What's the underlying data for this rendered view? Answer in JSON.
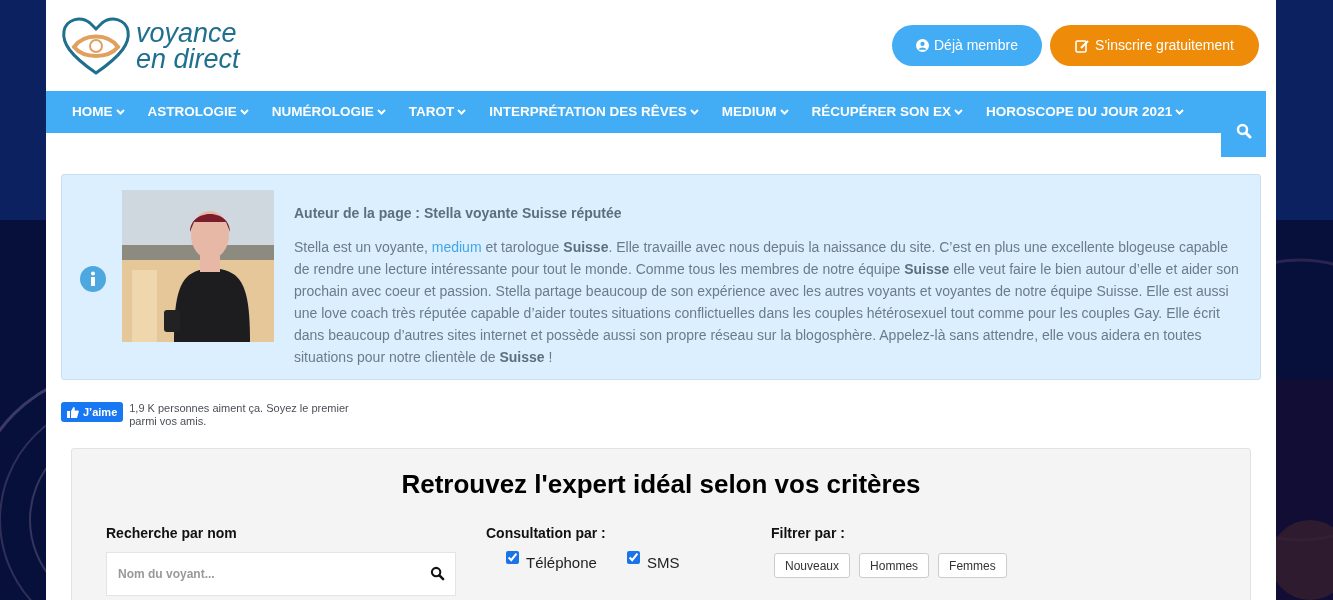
{
  "logo": {
    "line_1": "voyance",
    "line_2": "en direct"
  },
  "header_buttons": [
    {
      "kind": "member",
      "label": "Déjà membre"
    },
    {
      "kind": "signup",
      "label": "S'inscrire gratuitement"
    }
  ],
  "nav": {
    "items": [
      {
        "label": "HOME"
      },
      {
        "label": "ASTROLOGIE"
      },
      {
        "label": "NUMÉROLOGIE"
      },
      {
        "label": "TAROT"
      },
      {
        "label": "INTERPRÉTATION DES RÊVES"
      },
      {
        "label": "MEDIUM"
      },
      {
        "label": "RÉCUPÉRER SON EX"
      },
      {
        "label": "HOROSCOPE DU JOUR 2021"
      }
    ]
  },
  "author": {
    "title": "Auteur de la page : Stella voyante Suisse réputée",
    "bio_before": "Stella est un voyante, ",
    "bio_link": "medium",
    "bio_after": " et tarologue **Suisse**. Elle travaille avec nous depuis la naissance du site. C’est en plus une excellente blogeuse capable de rendre une lecture intéressante pour tout le monde. Comme tous les membres de notre équipe **Suisse** elle veut faire le bien autour d’elle et aider son prochain avec coeur et passion. Stella partage beaucoup de son expérience avec les autres voyants et voyantes de notre équipe Suisse. Elle est aussi une love coach très réputée capable d’aider toutes situations conflictuelles dans les couples hétérosexuel tout comme pour les couples Gay. Elle écrit dans beaucoup d’autres sites internet et possède aussi son propre réseau sur la blogosphère. Appelez-là sans attendre, elle vous aidera en toutes situations pour notre clientèle de **Suisse** !"
  },
  "like": {
    "button": "J’aime",
    "text": "1,9 K personnes aiment ça. Soyez le premier parmi vos amis."
  },
  "finder": {
    "title": "Retrouvez l'expert idéal selon vos critères",
    "name_search": {
      "label": "Recherche par nom",
      "placeholder": "Nom du voyant..."
    },
    "consultation": {
      "label": "Consultation par :",
      "options": [
        {
          "label": "Téléphone",
          "checked": true
        },
        {
          "label": "SMS",
          "checked": true
        }
      ]
    },
    "filter": {
      "label": "Filtrer par :",
      "options": [
        {
          "label": "Nouveaux"
        },
        {
          "label": "Hommes"
        },
        {
          "label": "Femmes"
        }
      ]
    }
  }
}
